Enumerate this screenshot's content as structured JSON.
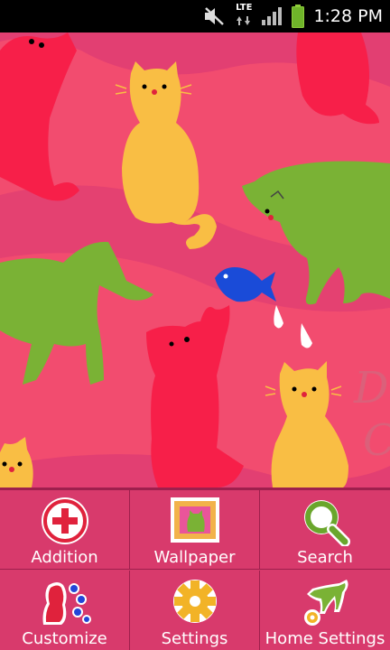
{
  "status_bar": {
    "network_type": "LTE",
    "time": "1:28 PM",
    "icons": [
      "mute-icon",
      "lte-icon",
      "signal-icon",
      "battery-icon"
    ]
  },
  "wallpaper": {
    "scene": "cats-wallpaper",
    "corner_text": "Da C",
    "colors": {
      "bg": "#f24c6f",
      "stripe": "#e23f72",
      "red_cat": "#f71f49",
      "yellow_cat": "#f9be44",
      "green_cat": "#7ab235",
      "fish": "#1a4bd8"
    }
  },
  "menu": {
    "colors": {
      "bg": "#d83a6c",
      "divider": "#9e1f4d",
      "label": "#ffffff"
    },
    "items": [
      {
        "label": "Addition",
        "icon": "add-circle-icon"
      },
      {
        "label": "Wallpaper",
        "icon": "wallpaper-icon"
      },
      {
        "label": "Search",
        "icon": "search-icon"
      },
      {
        "label": "Customize",
        "icon": "customize-paint-icon"
      },
      {
        "label": "Settings",
        "icon": "gear-icon"
      },
      {
        "label": "Home Settings",
        "icon": "home-settings-icon"
      }
    ]
  }
}
